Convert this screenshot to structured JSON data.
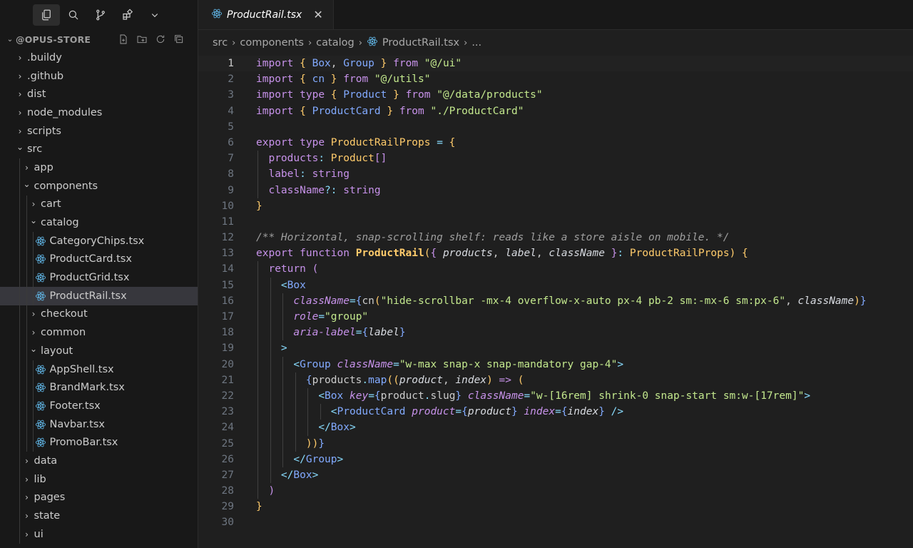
{
  "sidebar": {
    "root_label": "@OPUS-STORE",
    "tree": [
      {
        "label": ".buildy",
        "kind": "folder",
        "open": false,
        "depth": 0
      },
      {
        "label": ".github",
        "kind": "folder",
        "open": false,
        "depth": 0
      },
      {
        "label": "dist",
        "kind": "folder",
        "open": false,
        "depth": 0
      },
      {
        "label": "node_modules",
        "kind": "folder",
        "open": false,
        "depth": 0
      },
      {
        "label": "scripts",
        "kind": "folder",
        "open": false,
        "depth": 0
      },
      {
        "label": "src",
        "kind": "folder",
        "open": true,
        "depth": 0
      },
      {
        "label": "app",
        "kind": "folder",
        "open": false,
        "depth": 1
      },
      {
        "label": "components",
        "kind": "folder",
        "open": true,
        "depth": 1
      },
      {
        "label": "cart",
        "kind": "folder",
        "open": false,
        "depth": 2
      },
      {
        "label": "catalog",
        "kind": "folder",
        "open": true,
        "depth": 2
      },
      {
        "label": "CategoryChips.tsx",
        "kind": "file",
        "depth": 3
      },
      {
        "label": "ProductCard.tsx",
        "kind": "file",
        "depth": 3
      },
      {
        "label": "ProductGrid.tsx",
        "kind": "file",
        "depth": 3
      },
      {
        "label": "ProductRail.tsx",
        "kind": "file",
        "depth": 3,
        "selected": true
      },
      {
        "label": "checkout",
        "kind": "folder",
        "open": false,
        "depth": 2
      },
      {
        "label": "common",
        "kind": "folder",
        "open": false,
        "depth": 2
      },
      {
        "label": "layout",
        "kind": "folder",
        "open": true,
        "depth": 2
      },
      {
        "label": "AppShell.tsx",
        "kind": "file",
        "depth": 3
      },
      {
        "label": "BrandMark.tsx",
        "kind": "file",
        "depth": 3
      },
      {
        "label": "Footer.tsx",
        "kind": "file",
        "depth": 3
      },
      {
        "label": "Navbar.tsx",
        "kind": "file",
        "depth": 3
      },
      {
        "label": "PromoBar.tsx",
        "kind": "file",
        "depth": 3
      },
      {
        "label": "data",
        "kind": "folder",
        "open": false,
        "depth": 1
      },
      {
        "label": "lib",
        "kind": "folder",
        "open": false,
        "depth": 1
      },
      {
        "label": "pages",
        "kind": "folder",
        "open": false,
        "depth": 1
      },
      {
        "label": "state",
        "kind": "folder",
        "open": false,
        "depth": 1
      },
      {
        "label": "ui",
        "kind": "folder",
        "open": false,
        "depth": 1
      }
    ]
  },
  "tab": {
    "label": "ProductRail.tsx",
    "close": "✕"
  },
  "breadcrumb": {
    "parts": [
      "src",
      "components",
      "catalog"
    ],
    "file": "ProductRail.tsx",
    "more": "..."
  },
  "code": {
    "current_line": 1,
    "lines": [
      [
        [
          "k2",
          "import"
        ],
        [
          "idn",
          " "
        ],
        [
          "t2",
          "{"
        ],
        [
          "idn",
          " "
        ],
        [
          "f2",
          "Box"
        ],
        [
          "idn",
          ", "
        ],
        [
          "f2",
          "Group"
        ],
        [
          "idn",
          " "
        ],
        [
          "t2",
          "}"
        ],
        [
          "idn",
          " "
        ],
        [
          "k2",
          "from"
        ],
        [
          "idn",
          " "
        ],
        [
          "s2",
          "\"@/ui\""
        ]
      ],
      [
        [
          "k2",
          "import"
        ],
        [
          "idn",
          " "
        ],
        [
          "t2",
          "{"
        ],
        [
          "idn",
          " "
        ],
        [
          "f2",
          "cn"
        ],
        [
          "idn",
          " "
        ],
        [
          "t2",
          "}"
        ],
        [
          "idn",
          " "
        ],
        [
          "k2",
          "from"
        ],
        [
          "idn",
          " "
        ],
        [
          "s2",
          "\"@/utils\""
        ]
      ],
      [
        [
          "k2",
          "import"
        ],
        [
          "idn",
          " "
        ],
        [
          "k2",
          "type"
        ],
        [
          "idn",
          " "
        ],
        [
          "t2",
          "{"
        ],
        [
          "idn",
          " "
        ],
        [
          "f2",
          "Product"
        ],
        [
          "idn",
          " "
        ],
        [
          "t2",
          "}"
        ],
        [
          "idn",
          " "
        ],
        [
          "k2",
          "from"
        ],
        [
          "idn",
          " "
        ],
        [
          "s2",
          "\"@/data/products\""
        ]
      ],
      [
        [
          "k2",
          "import"
        ],
        [
          "idn",
          " "
        ],
        [
          "t2",
          "{"
        ],
        [
          "idn",
          " "
        ],
        [
          "f2",
          "ProductCard"
        ],
        [
          "idn",
          " "
        ],
        [
          "t2",
          "}"
        ],
        [
          "idn",
          " "
        ],
        [
          "k2",
          "from"
        ],
        [
          "idn",
          " "
        ],
        [
          "s2",
          "\"./ProductCard\""
        ]
      ],
      [],
      [
        [
          "k2",
          "export"
        ],
        [
          "idn",
          " "
        ],
        [
          "k2",
          "type"
        ],
        [
          "idn",
          " "
        ],
        [
          "t2",
          "ProductRailProps"
        ],
        [
          "idn",
          " "
        ],
        [
          "p2",
          "="
        ],
        [
          "idn",
          " "
        ],
        [
          "t2",
          "{"
        ]
      ],
      [
        [
          "idn",
          "  "
        ],
        [
          "k2",
          "products"
        ],
        [
          "p2",
          ":"
        ],
        [
          "idn",
          " "
        ],
        [
          "t2",
          "Product"
        ],
        [
          "k2",
          "[]"
        ]
      ],
      [
        [
          "idn",
          "  "
        ],
        [
          "k2",
          "label"
        ],
        [
          "p2",
          ":"
        ],
        [
          "idn",
          " "
        ],
        [
          "k2",
          "string"
        ]
      ],
      [
        [
          "idn",
          "  "
        ],
        [
          "k2",
          "className"
        ],
        [
          "p2",
          "?:"
        ],
        [
          "idn",
          " "
        ],
        [
          "k2",
          "string"
        ]
      ],
      [
        [
          "t2",
          "}"
        ]
      ],
      [],
      [
        [
          "c2",
          "/** Horizontal, snap-scrolling shelf: reads like a store aisle on mobile. */"
        ]
      ],
      [
        [
          "k2",
          "export"
        ],
        [
          "idn",
          " "
        ],
        [
          "k2",
          "function"
        ],
        [
          "idn",
          " "
        ],
        [
          "fnb",
          "ProductRail"
        ],
        [
          "t2",
          "("
        ],
        [
          "k2",
          "{"
        ],
        [
          "idn",
          " "
        ],
        [
          "italicv",
          "products"
        ],
        [
          "idn",
          ", "
        ],
        [
          "italicv",
          "label"
        ],
        [
          "idn",
          ", "
        ],
        [
          "italicv",
          "className"
        ],
        [
          "idn",
          " "
        ],
        [
          "k2",
          "}"
        ],
        [
          "p2",
          ":"
        ],
        [
          "idn",
          " "
        ],
        [
          "t2",
          "ProductRailProps"
        ],
        [
          "t2",
          ")"
        ],
        [
          "idn",
          " "
        ],
        [
          "t2",
          "{"
        ]
      ],
      [
        [
          "idn",
          "  "
        ],
        [
          "k2",
          "return"
        ],
        [
          "idn",
          " "
        ],
        [
          "k2",
          "("
        ]
      ],
      [
        [
          "idn",
          "    "
        ],
        [
          "p2",
          "<"
        ],
        [
          "f2",
          "Box"
        ]
      ],
      [
        [
          "idn",
          "      "
        ],
        [
          "i2",
          "className"
        ],
        [
          "p2",
          "="
        ],
        [
          "f2",
          "{"
        ],
        [
          "idn",
          "cn"
        ],
        [
          "t2",
          "("
        ],
        [
          "s2",
          "\"hide-scrollbar -mx-4 overflow-x-auto px-4 pb-2 sm:-mx-6 sm:px-6\""
        ],
        [
          "idn",
          ", "
        ],
        [
          "italicv",
          "className"
        ],
        [
          "t2",
          ")"
        ],
        [
          "f2",
          "}"
        ]
      ],
      [
        [
          "idn",
          "      "
        ],
        [
          "i2",
          "role"
        ],
        [
          "p2",
          "="
        ],
        [
          "s2",
          "\"group\""
        ]
      ],
      [
        [
          "idn",
          "      "
        ],
        [
          "i2",
          "aria-label"
        ],
        [
          "p2",
          "="
        ],
        [
          "f2",
          "{"
        ],
        [
          "italicv",
          "label"
        ],
        [
          "f2",
          "}"
        ]
      ],
      [
        [
          "idn",
          "    "
        ],
        [
          "p2",
          ">"
        ]
      ],
      [
        [
          "idn",
          "      "
        ],
        [
          "p2",
          "<"
        ],
        [
          "f2",
          "Group"
        ],
        [
          "idn",
          " "
        ],
        [
          "i2",
          "className"
        ],
        [
          "p2",
          "="
        ],
        [
          "s2",
          "\"w-max snap-x snap-mandatory gap-4\""
        ],
        [
          "p2",
          ">"
        ]
      ],
      [
        [
          "idn",
          "        "
        ],
        [
          "f2",
          "{"
        ],
        [
          "idn",
          "products"
        ],
        [
          "p2",
          "."
        ],
        [
          "f2",
          "map"
        ],
        [
          "t2",
          "(("
        ],
        [
          "italicv",
          "product"
        ],
        [
          "idn",
          ", "
        ],
        [
          "italicv",
          "index"
        ],
        [
          "t2",
          ")"
        ],
        [
          "idn",
          " "
        ],
        [
          "k2",
          "=>"
        ],
        [
          "idn",
          " "
        ],
        [
          "t2",
          "("
        ]
      ],
      [
        [
          "idn",
          "          "
        ],
        [
          "p2",
          "<"
        ],
        [
          "f2",
          "Box"
        ],
        [
          "idn",
          " "
        ],
        [
          "i2",
          "key"
        ],
        [
          "p2",
          "="
        ],
        [
          "f2",
          "{"
        ],
        [
          "idn",
          "product"
        ],
        [
          "p2",
          "."
        ],
        [
          "idn",
          "slug"
        ],
        [
          "f2",
          "}"
        ],
        [
          "idn",
          " "
        ],
        [
          "i2",
          "className"
        ],
        [
          "p2",
          "="
        ],
        [
          "s2",
          "\"w-[16rem] shrink-0 snap-start sm:w-[17rem]\""
        ],
        [
          "p2",
          ">"
        ]
      ],
      [
        [
          "idn",
          "            "
        ],
        [
          "p2",
          "<"
        ],
        [
          "f2",
          "ProductCard"
        ],
        [
          "idn",
          " "
        ],
        [
          "i2",
          "product"
        ],
        [
          "p2",
          "="
        ],
        [
          "f2",
          "{"
        ],
        [
          "italicv",
          "product"
        ],
        [
          "f2",
          "}"
        ],
        [
          "idn",
          " "
        ],
        [
          "i2",
          "index"
        ],
        [
          "p2",
          "="
        ],
        [
          "f2",
          "{"
        ],
        [
          "italicv",
          "index"
        ],
        [
          "f2",
          "}"
        ],
        [
          "idn",
          " "
        ],
        [
          "p2",
          "/>"
        ]
      ],
      [
        [
          "idn",
          "          "
        ],
        [
          "p2",
          "</"
        ],
        [
          "f2",
          "Box"
        ],
        [
          "p2",
          ">"
        ]
      ],
      [
        [
          "idn",
          "        "
        ],
        [
          "t2",
          "))"
        ],
        [
          "f2",
          "}"
        ]
      ],
      [
        [
          "idn",
          "      "
        ],
        [
          "p2",
          "</"
        ],
        [
          "f2",
          "Group"
        ],
        [
          "p2",
          ">"
        ]
      ],
      [
        [
          "idn",
          "    "
        ],
        [
          "p2",
          "</"
        ],
        [
          "f2",
          "Box"
        ],
        [
          "p2",
          ">"
        ]
      ],
      [
        [
          "idn",
          "  "
        ],
        [
          "k2",
          ")"
        ]
      ],
      [
        [
          "t2",
          "}"
        ]
      ],
      []
    ]
  }
}
